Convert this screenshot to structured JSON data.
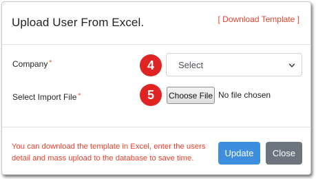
{
  "modal": {
    "title": "Upload User From Excel.",
    "download_link": "[ Download Template ]"
  },
  "form": {
    "company": {
      "label": "Company",
      "required_mark": "*",
      "step": "4",
      "selected": "Select"
    },
    "import_file": {
      "label": "Select Import File",
      "required_mark": "*",
      "step": "5",
      "button_label": "Choose File",
      "status": "No file chosen"
    }
  },
  "footer": {
    "note": "You can download the template in Excel, enter the users detail and mass upload to the database to save time.",
    "update_label": "Update",
    "close_label": "Close"
  },
  "colors": {
    "accent_red": "#e8412c",
    "badge_red": "#e02424",
    "primary_blue": "#3e8ee0",
    "secondary_gray": "#6c757d"
  }
}
